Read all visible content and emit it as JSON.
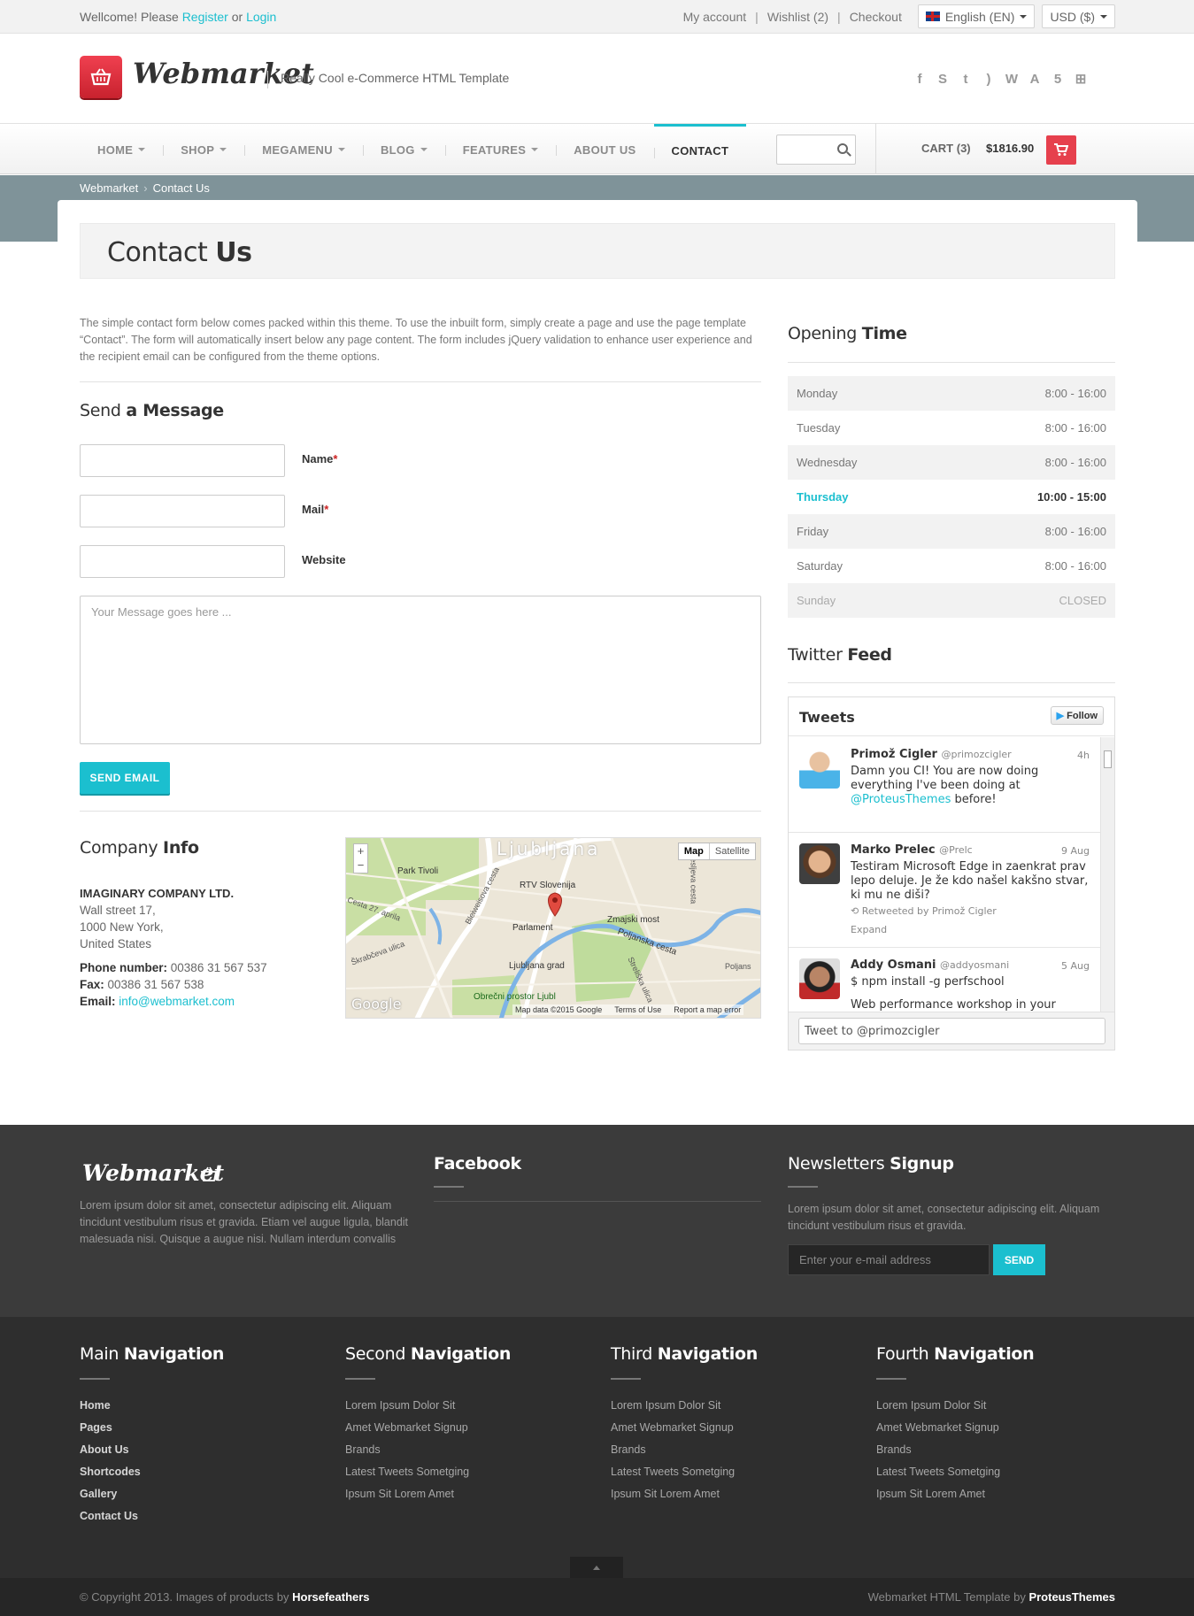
{
  "topbar": {
    "welcome": "Wellcome! Please",
    "register": "Register",
    "or": "or",
    "login": "Login",
    "links": [
      "My account",
      "Wishlist (2)",
      "Checkout"
    ],
    "language": "English (EN)",
    "currency": "USD ($)"
  },
  "header": {
    "logo_text": "Webmarket",
    "tagline": "Really Cool e-Commerce HTML Template",
    "social_icons": [
      "facebook-icon",
      "skype-icon",
      "twitter-icon",
      "rss-icon",
      "wordpress-icon",
      "android-icon",
      "html5-icon",
      "windows-icon"
    ]
  },
  "nav": {
    "items": [
      "HOME",
      "SHOP",
      "MEGAMENU",
      "BLOG",
      "FEATURES",
      "ABOUT US",
      "CONTACT"
    ],
    "active": "CONTACT",
    "cart_label": "CART",
    "cart_count": "(3)",
    "cart_total": "$1816.90"
  },
  "breadcrumb": [
    "Webmarket",
    "Contact Us"
  ],
  "page": {
    "title_light": "Contact",
    "title_bold": "Us"
  },
  "intro": "The simple contact form below comes packed within this theme. To use the inbuilt form, simply create a page and use the page template “Contact”. The form will automatically insert below any page content. The form includes jQuery validation to enhance user experience and the recipient email can be configured from the theme options.",
  "form": {
    "heading_light": "Send",
    "heading_bold": "a Message",
    "name_label": "Name",
    "mail_label": "Mail",
    "website_label": "Website",
    "message_placeholder": "Your Message goes here ...",
    "submit": "SEND EMAIL"
  },
  "company": {
    "heading_light": "Company",
    "heading_bold": "Info",
    "name": "IMAGINARY COMPANY LTD.",
    "address": [
      "Wall street 17,",
      "1000 New York,",
      "United States"
    ],
    "phone_label": "Phone number:",
    "phone": "00386 31 567 537",
    "fax_label": "Fax:",
    "fax": "00386 31 567 538",
    "email_label": "Email:",
    "email": "info@webmarket.com"
  },
  "map": {
    "city": "Ljubljana",
    "labels": [
      "Park Tivoli",
      "RTV Slovenija",
      "Zmajski most",
      "Parlament",
      "Ljubljana grad",
      "Poljanska cesta",
      "Obrečni prostor Ljubl",
      "Bleiweisova cesta",
      "Cesta 27. aprila",
      "Škrabčeva ulica",
      "Poljans",
      "Resljeva cesta",
      "Streliška ulica"
    ],
    "map_btn": "Map",
    "satellite_btn": "Satellite",
    "footer": [
      "Map data ©2015 Google",
      "Terms of Use",
      "Report a map error"
    ],
    "google": "Google"
  },
  "opening": {
    "heading_light": "Opening",
    "heading_bold": "Time",
    "rows": [
      {
        "day": "Monday",
        "time": "8:00 - 16:00"
      },
      {
        "day": "Tuesday",
        "time": "8:00 - 16:00"
      },
      {
        "day": "Wednesday",
        "time": "8:00 - 16:00"
      },
      {
        "day": "Thursday",
        "time": "10:00 - 15:00"
      },
      {
        "day": "Friday",
        "time": "8:00 - 16:00"
      },
      {
        "day": "Saturday",
        "time": "8:00 - 16:00"
      },
      {
        "day": "Sunday",
        "time": "CLOSED"
      }
    ]
  },
  "twitter": {
    "heading_light": "Twitter",
    "heading_bold": "Feed",
    "title": "Tweets",
    "follow": "Follow",
    "tweets": [
      {
        "name": "Primož Cigler",
        "handle": "@primozcigler",
        "time": "4h",
        "text": "Damn you CI! You are now doing everything I've been doing at",
        "link": "@ProteusThemes",
        "text_after": "before!"
      },
      {
        "name": "Marko Prelec",
        "handle": "@Prelc",
        "time": "9 Aug",
        "text": "Testiram Microsoft Edge in zaenkrat prav lepo deluje. Je že kdo našel kakšno stvar, ki mu ne diši?",
        "retweet": "Retweeted by Primož Cigler",
        "expand": "Expand"
      },
      {
        "name": "Addy Osmani",
        "handle": "@addyosmani",
        "time": "5 Aug",
        "text": "$ npm install -g perfschool",
        "text2": "Web performance workshop in your"
      }
    ],
    "reply_placeholder": "Tweet to @primozcigler"
  },
  "footer": {
    "logo": "Webmarket",
    "about": "Lorem ipsum dolor sit amet, consectetur adipiscing elit. Aliquam tincidunt vestibulum risus et gravida. Etiam vel augue ligula, blandit malesuada nisi. Quisque a augue nisi. Nullam interdum convallis",
    "facebook": "Facebook",
    "newsletter_light": "Newsletters",
    "newsletter_bold": "Signup",
    "newsletter_text": "Lorem ipsum dolor sit amet, consectetur adipiscing elit. Aliquam tincidunt vestibulum risus et gravida.",
    "email_placeholder": "Enter your e-mail address",
    "send": "SEND",
    "columns": [
      {
        "light": "Main",
        "bold": "Navigation",
        "items": [
          "Home",
          "Pages",
          "About Us",
          "Shortcodes",
          "Gallery",
          "Contact Us"
        ]
      },
      {
        "light": "Second",
        "bold": "Navigation",
        "items": [
          "Lorem Ipsum Dolor Sit",
          "Amet Webmarket Signup",
          "Brands",
          "Latest Tweets Sometging",
          "Ipsum Sit Lorem Amet"
        ]
      },
      {
        "light": "Third",
        "bold": "Navigation",
        "items": [
          "Lorem Ipsum Dolor Sit",
          "Amet Webmarket Signup",
          "Brands",
          "Latest Tweets Sometging",
          "Ipsum Sit Lorem Amet"
        ]
      },
      {
        "light": "Fourth",
        "bold": "Navigation",
        "items": [
          "Lorem Ipsum Dolor Sit",
          "Amet Webmarket Signup",
          "Brands",
          "Latest Tweets Sometging",
          "Ipsum Sit Lorem Amet"
        ]
      }
    ],
    "copyright": "© Copyright 2013. Images of products by",
    "copyright_by": "Horsefeathers",
    "credit": "Webmarket HTML Template by",
    "credit_by": "ProteusThemes"
  },
  "colors": {
    "accent": "#1bbfcf",
    "brand_red": "#e6404d",
    "band": "#7f9399"
  }
}
